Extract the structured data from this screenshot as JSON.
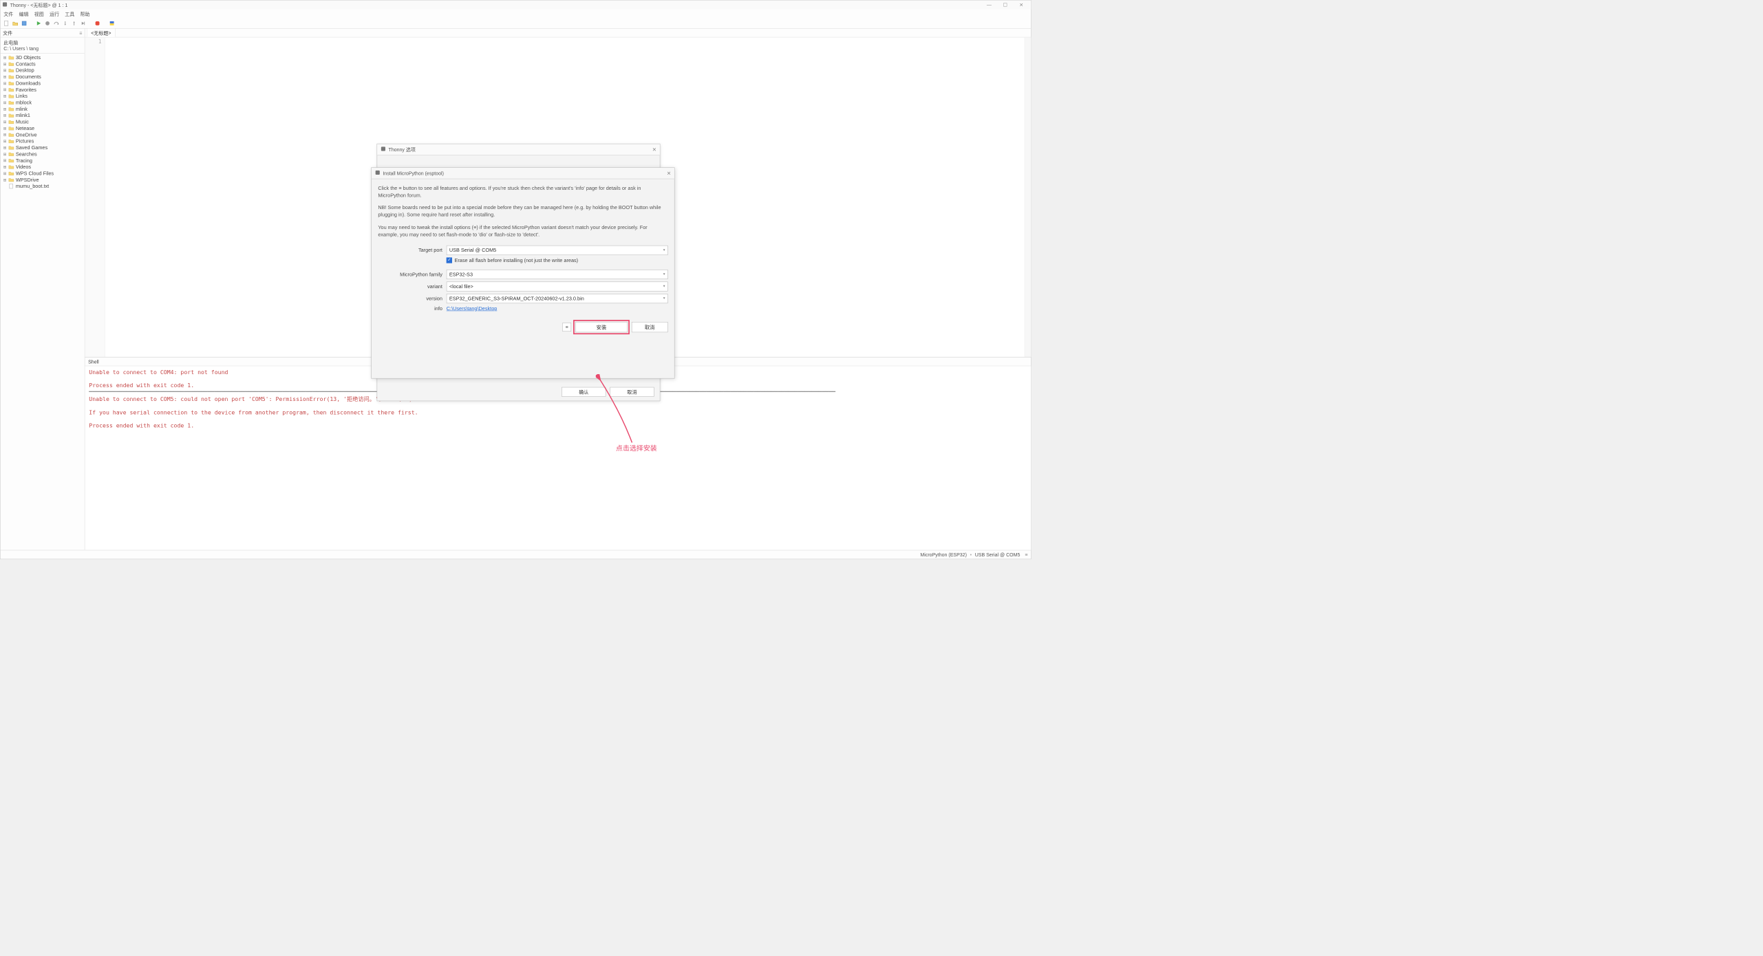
{
  "window": {
    "title": "Thonny  -  <无标题>  @  1 : 1"
  },
  "menu": [
    "文件",
    "编辑",
    "视图",
    "运行",
    "工具",
    "帮助"
  ],
  "sidebar": {
    "title": "文件",
    "root_line1": "此电脑",
    "root_line2": "C: \\ Users \\ tang",
    "items": [
      {
        "name": "3D Objects",
        "type": "folder"
      },
      {
        "name": "Contacts",
        "type": "folder"
      },
      {
        "name": "Desktop",
        "type": "folder"
      },
      {
        "name": "Documents",
        "type": "folder"
      },
      {
        "name": "Downloads",
        "type": "folder"
      },
      {
        "name": "Favorites",
        "type": "folder"
      },
      {
        "name": "Links",
        "type": "folder"
      },
      {
        "name": "mblock",
        "type": "folder"
      },
      {
        "name": "mlink",
        "type": "folder"
      },
      {
        "name": "mlink1",
        "type": "folder"
      },
      {
        "name": "Music",
        "type": "folder"
      },
      {
        "name": "Netease",
        "type": "folder"
      },
      {
        "name": "OneDrive",
        "type": "folder"
      },
      {
        "name": "Pictures",
        "type": "folder"
      },
      {
        "name": "Saved Games",
        "type": "folder"
      },
      {
        "name": "Searches",
        "type": "folder"
      },
      {
        "name": "Tracing",
        "type": "folder"
      },
      {
        "name": "Videos",
        "type": "folder"
      },
      {
        "name": "WPS Cloud Files",
        "type": "folder"
      },
      {
        "name": "WPSDrive",
        "type": "folder"
      },
      {
        "name": "mumu_boot.txt",
        "type": "file"
      }
    ]
  },
  "editor": {
    "tab": "<无标题>",
    "gutter_line": "1"
  },
  "shell": {
    "title": "Shell",
    "lines": [
      {
        "cls": "err",
        "t": "Unable to connect to COM4: port not found"
      },
      {
        "cls": "err",
        "t": ""
      },
      {
        "cls": "err",
        "t": "Process ended with exit code 1."
      },
      {
        "cls": "blk",
        "t": "────────────────────────────────────────────────────────────────────────────────────────────────────────────────────────────────────────────────────────────────────────────────────────────────────────────────────────────"
      },
      {
        "cls": "err",
        "t": "Unable to connect to COM5: could not open port 'COM5': PermissionError(13, '拒绝访问。', None, 5)"
      },
      {
        "cls": "err",
        "t": ""
      },
      {
        "cls": "err",
        "t": "If you have serial connection to the device from another program, then disconnect it there first."
      },
      {
        "cls": "err",
        "t": ""
      },
      {
        "cls": "err",
        "t": "Process ended with exit code 1."
      }
    ]
  },
  "status": {
    "left": "MicroPython (ESP32)",
    "right": "USB Serial @ COM5"
  },
  "options_dialog": {
    "title": "Thonny 选项",
    "ok": "确认",
    "cancel": "取消"
  },
  "install_dialog": {
    "title": "Install MicroPython (esptool)",
    "para1": "Click the ≡ button to see all features and options. If you're stuck then check the variant's 'info' page for details or ask in MicroPython forum.",
    "para2": "NB! Some boards need to be put into a special mode before they can be managed here (e.g. by holding the BOOT button while plugging in). Some require hard reset after installing.",
    "para3": "You may need to tweak the install options (≡) if the selected MicroPython variant doesn't match your device precisely. For example, you may need to set flash-mode to 'dio' or flash-size to 'detect'.",
    "labels": {
      "target_port": "Target port",
      "erase": "Erase all flash before installing (not just the write areas)",
      "family": "MicroPython family",
      "variant": "variant",
      "version": "version",
      "info": "info"
    },
    "values": {
      "target_port": "USB Serial @ COM5",
      "family": "ESP32-S3",
      "variant": "<local file>",
      "version": "ESP32_GENERIC_S3-SPIRAM_OCT-20240602-v1.23.0.bin",
      "info": "C:\\Users\\tang\\Desktop"
    },
    "install": "安装",
    "cancel": "取消"
  },
  "annotation": "点击选择安装"
}
